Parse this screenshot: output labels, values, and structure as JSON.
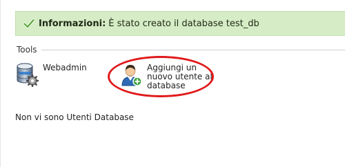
{
  "alert": {
    "label": "Informazioni:",
    "message": "È stato creato il database test_db",
    "icon": "check-icon",
    "background_color": "#d6ecc6"
  },
  "tools": {
    "heading": "Tools",
    "items": [
      {
        "label": "Webadmin",
        "icon": "database-gear-icon"
      },
      {
        "label": "Aggiungi un nuovo utente al database",
        "icon": "add-user-icon"
      }
    ]
  },
  "empty_message": "Non vi sono Utenti Database",
  "colors": {
    "highlight_ring": "#e0191b"
  }
}
